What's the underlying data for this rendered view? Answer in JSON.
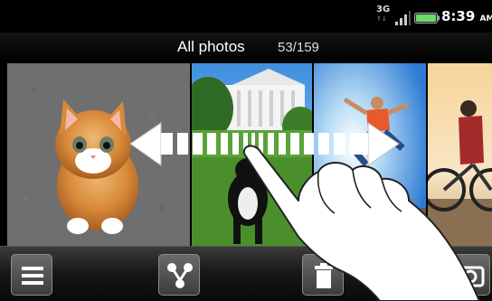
{
  "status_bar": {
    "network_type": "3G",
    "time": "8:39",
    "ampm": "AM",
    "signal_icon": "signal-bars-icon",
    "battery_icon": "battery-icon",
    "battery_color": "#6fd86a"
  },
  "header": {
    "title": "All photos",
    "counter": "53/159"
  },
  "photos": [
    {
      "subject": "kitten"
    },
    {
      "subject": "white-house"
    },
    {
      "subject": "jumping-man"
    },
    {
      "subject": "cyclist"
    }
  ],
  "toolbar": {
    "menu_icon": "menu-icon",
    "share_icon": "share-icon",
    "delete_icon": "trash-icon",
    "camera_icon": "camera-icon"
  },
  "gesture": {
    "description_icon": "swipe-hand-icon",
    "arrow": "double-arrow-icon"
  }
}
